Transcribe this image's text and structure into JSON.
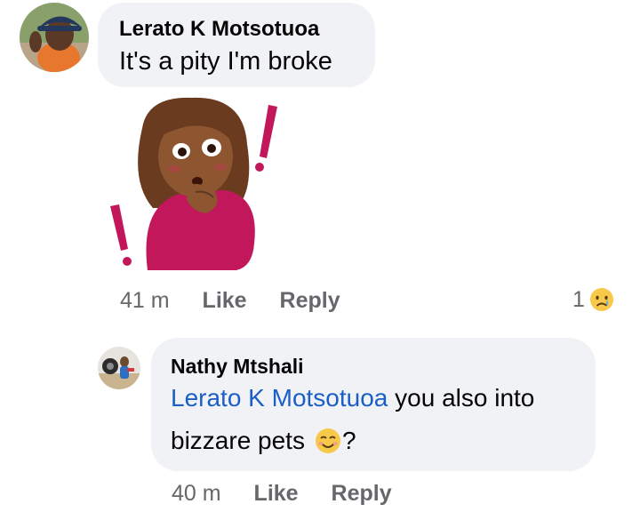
{
  "comments": [
    {
      "author": "Lerato K Motsotuoa",
      "text": "It's a pity I'm broke",
      "time": "41 m",
      "like_label": "Like",
      "reply_label": "Reply",
      "reaction_count": "1",
      "reaction_icon": "crying-face-icon"
    }
  ],
  "reply": {
    "author": "Nathy Mtshali",
    "mention": "Lerato K Motsotuoa",
    "text_line1_rest": " you also into",
    "text_line2": "bizzare pets",
    "text_end": "?",
    "emoji_icon": "smiling-face-icon",
    "time": "40 m",
    "like_label": "Like",
    "reply_label": "Reply"
  },
  "colors": {
    "bubble": "#f0f2f5",
    "mention": "#1b5fc6",
    "meta": "#65676b",
    "sticker_exclaim": "#c2185b"
  }
}
